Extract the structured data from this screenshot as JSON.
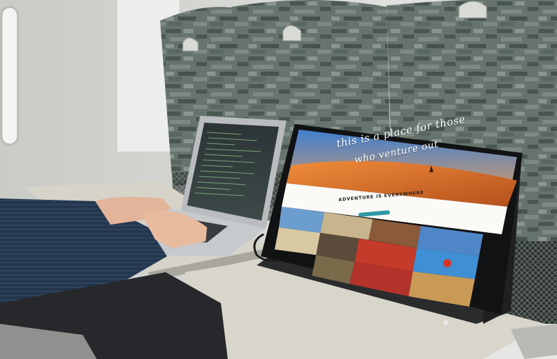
{
  "scene": {
    "description_free": true
  },
  "monitor": {
    "hero_line1": "this is a place for those",
    "hero_line2": "who venture out",
    "hero_subtext": "",
    "section_heading": "ADVENTURE IS EVERYWHERE",
    "logo_icon": "x-logo-icon"
  },
  "colors": {
    "desert_sky": "#4d8fd6",
    "desert_sand": "#d9742a",
    "seat_fabric": "#5f6d66",
    "button_teal": "#2f9aa6",
    "tray": "#d6d3c8"
  }
}
